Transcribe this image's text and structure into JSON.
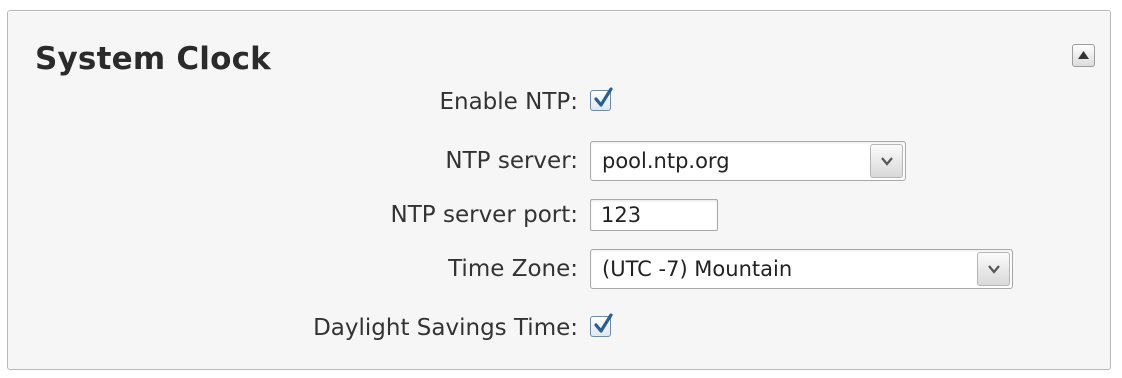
{
  "panel": {
    "title": "System Clock",
    "collapse_icon": "triangle-up-icon"
  },
  "fields": {
    "enable_ntp": {
      "label": "Enable NTP:",
      "checked": true
    },
    "ntp_server": {
      "label": "NTP server:",
      "value": "pool.ntp.org"
    },
    "ntp_server_port": {
      "label": "NTP server port:",
      "value": "123"
    },
    "time_zone": {
      "label": "Time Zone:",
      "value": "(UTC -7) Mountain"
    },
    "daylight_savings": {
      "label": "Daylight Savings Time:",
      "checked": true
    }
  },
  "colors": {
    "checkmark": "#2b5e91",
    "panel_background": "#f6f6f6",
    "panel_border": "#b8b8b8"
  }
}
